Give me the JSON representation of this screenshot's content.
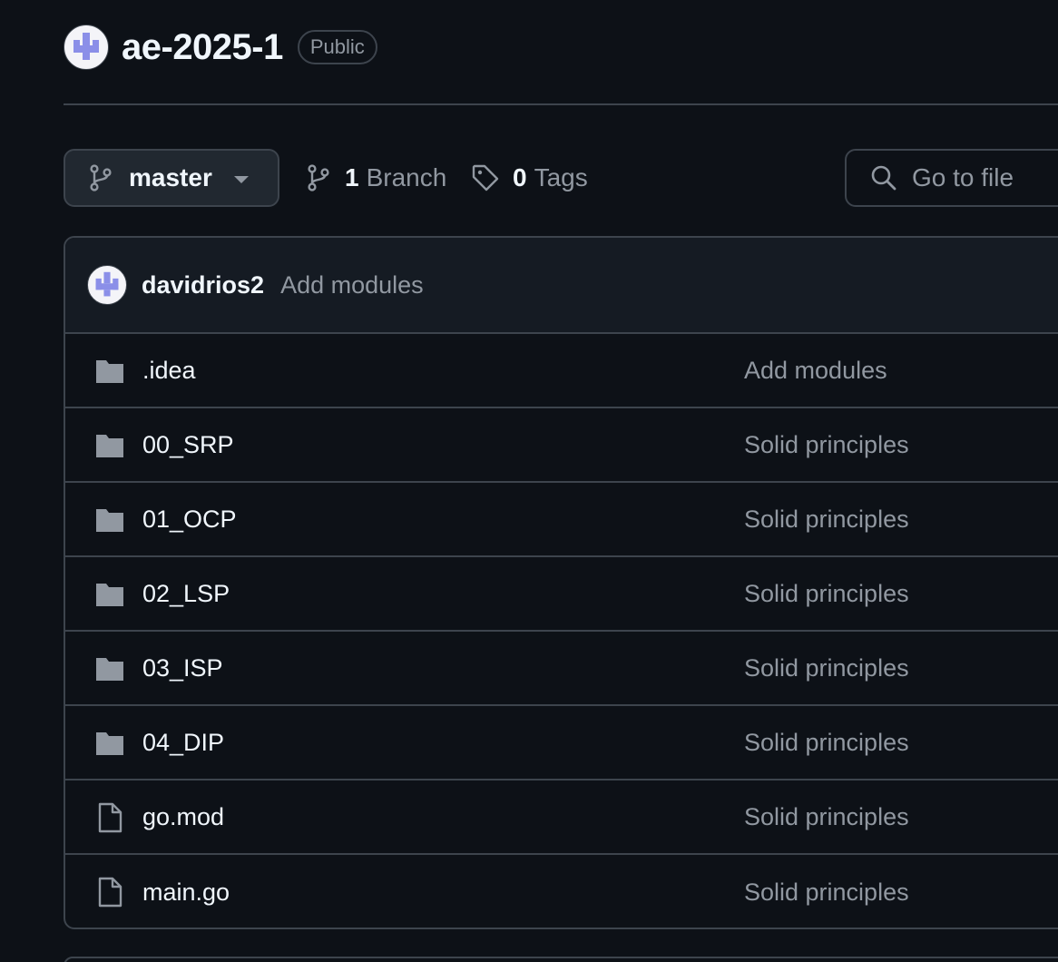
{
  "repo": {
    "name": "ae-2025-1",
    "visibility": "Public"
  },
  "toolbar": {
    "branch": "master",
    "branch_count": "1",
    "branch_label": "Branch",
    "tag_count": "0",
    "tag_label": "Tags",
    "search_placeholder": "Go to file"
  },
  "latest_commit": {
    "author": "davidrios2",
    "message": "Add modules"
  },
  "files": [
    {
      "name": ".idea",
      "type": "folder-icon",
      "commit": "Add modules"
    },
    {
      "name": "00_SRP",
      "type": "folder-icon",
      "commit": "Solid principles"
    },
    {
      "name": "01_OCP",
      "type": "folder-icon",
      "commit": "Solid principles"
    },
    {
      "name": "02_LSP",
      "type": "folder-icon",
      "commit": "Solid principles"
    },
    {
      "name": "03_ISP",
      "type": "folder-icon",
      "commit": "Solid principles"
    },
    {
      "name": "04_DIP",
      "type": "folder-icon",
      "commit": "Solid principles"
    },
    {
      "name": "go.mod",
      "type": "file-icon",
      "commit": "Solid principles"
    },
    {
      "name": "main.go",
      "type": "file-icon",
      "commit": "Solid principles"
    }
  ],
  "colors": {
    "background": "#0d1117",
    "border": "#3d444d",
    "text": "#f0f6fc",
    "muted": "#9198a1",
    "icon": "#9198a1",
    "avatar_accent": "#8b8fe8"
  }
}
